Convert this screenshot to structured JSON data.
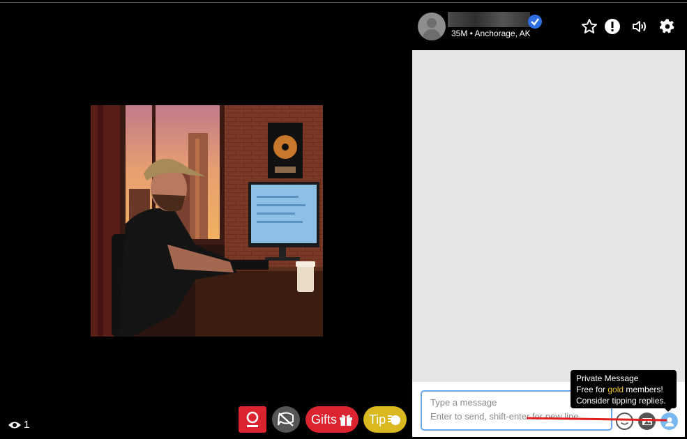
{
  "profile": {
    "subinfo": "35M • Anchorage, AK"
  },
  "header_icons": [
    "star-icon",
    "alert-icon",
    "volume-icon",
    "gear-icon"
  ],
  "composer": {
    "placeholder_line1": "Type a message",
    "placeholder_line2": "Enter to send, shift-enter for new line"
  },
  "tooltip": {
    "title": "Private Message",
    "line2_pre": "Free for ",
    "line2_gold": "gold",
    "line2_post": " members!",
    "line3": "Consider tipping replies."
  },
  "viewers": {
    "count": "1"
  },
  "controls": {
    "gifts_label": "Gifts",
    "tip_label": "Tip"
  },
  "colors": {
    "accent_red": "#dc2430",
    "tip_yellow": "#d9b820",
    "chat_bg": "#e6e6e6",
    "verified_blue": "#2d6fe3",
    "gold_text": "#f2c230"
  }
}
